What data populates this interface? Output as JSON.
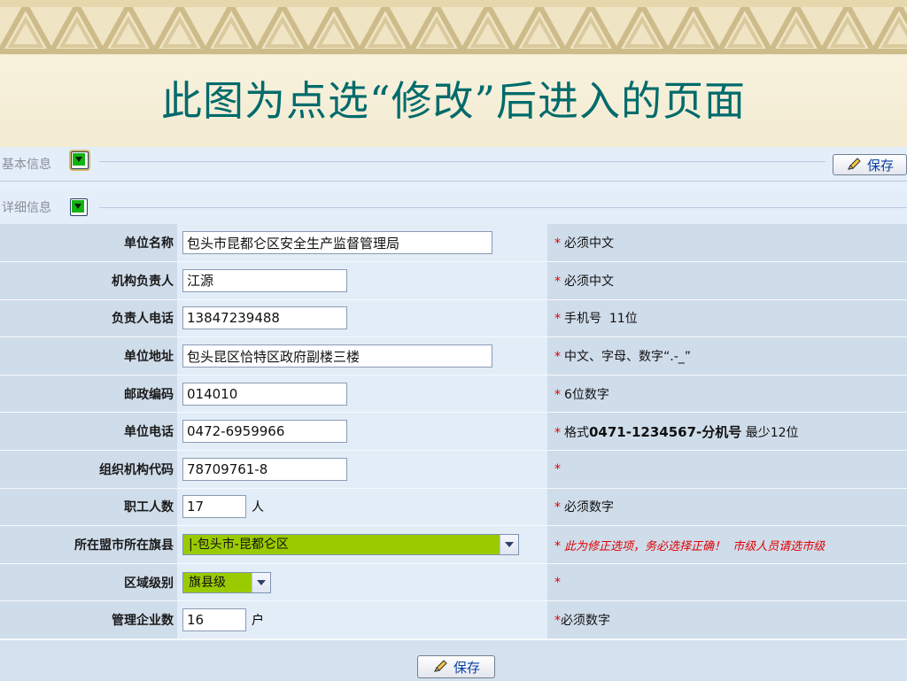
{
  "slide": {
    "title": "此图为点选“修改”后进入的页面"
  },
  "sections": {
    "basic": {
      "label": "基本信息",
      "save_label": "保存"
    },
    "detail": {
      "label": "详细信息"
    }
  },
  "form": {
    "rows": [
      {
        "label": "单位名称",
        "value": "包头市昆都仑区安全生产监督管理局",
        "hint_star": "*",
        "hint": "必须中文"
      },
      {
        "label": "机构负责人",
        "value": "江源",
        "hint_star": "*",
        "hint": "必须中文"
      },
      {
        "label": "负责人电话",
        "value": "13847239488",
        "hint_star": "*",
        "hint": "手机号  11位"
      },
      {
        "label": "单位地址",
        "value": "包头昆区恰特区政府副楼三楼",
        "hint_star": "*",
        "hint": "中文、字母、数字“.-_”"
      },
      {
        "label": "邮政编码",
        "value": "014010",
        "hint_star": "*",
        "hint": "6位数字"
      },
      {
        "label": "单位电话",
        "value": "0472-6959966",
        "hint_star": "*",
        "hint_prefix": "格式",
        "hint_bold": "0471-1234567-分机号",
        "hint_suffix": " 最少12位"
      },
      {
        "label": "组织机构代码",
        "value": "78709761-8",
        "hint_star": "*"
      },
      {
        "label": "职工人数",
        "value": "17",
        "unit": "人",
        "hint_star": "*",
        "hint": "必须数字"
      },
      {
        "label": "所在盟市所在旗县",
        "select_value": "|-包头市-昆都仑区",
        "hint_star": "*",
        "warning": "此为修正选项，务必选择正确！  市级人员请选市级"
      },
      {
        "label": "区域级别",
        "select_value": "旗县级",
        "hint_star": "*"
      },
      {
        "label": "管理企业数",
        "value": "16",
        "unit": "户",
        "hint_star": "*",
        "hint": "必须数字"
      }
    ]
  },
  "footer": {
    "save_label": "保存"
  },
  "colors": {
    "accent_green": "#9acb00",
    "required_red": "#e00000",
    "title_teal": "#006b6b"
  },
  "icons": [
    "pencil-icon",
    "expand-toggle-icon",
    "chevron-down-icon"
  ]
}
